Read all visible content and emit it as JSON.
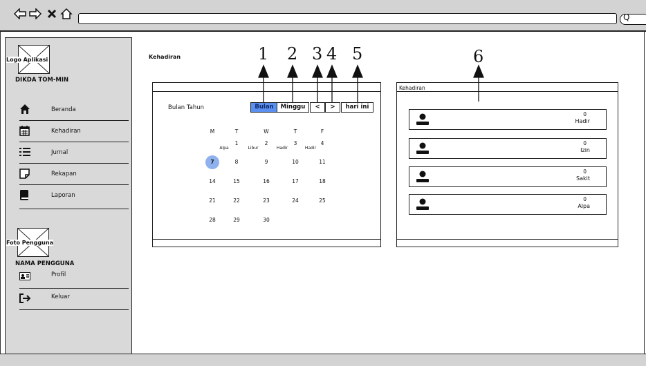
{
  "browser": {
    "back_icon": "back-arrow-icon",
    "forward_icon": "forward-arrow-icon",
    "close_icon": "close-icon",
    "home_icon": "home-icon",
    "search_glyph": "Q"
  },
  "sidebar": {
    "logo_label": "Logo Aplikasi",
    "app_name": "DIKDA TOM-MIN",
    "items": [
      {
        "label": "Beranda",
        "icon": "home-icon"
      },
      {
        "label": "Kehadiran",
        "icon": "calendar-icon"
      },
      {
        "label": "Jurnal",
        "icon": "list-icon"
      },
      {
        "label": "Rekapan",
        "icon": "note-icon"
      },
      {
        "label": "Laporan",
        "icon": "book-icon"
      }
    ],
    "photo_label": "Foto Pengguna",
    "user_name": "NAMA PENGGUNA",
    "user_items": [
      {
        "label": "Profil",
        "icon": "id-card-icon"
      },
      {
        "label": "Keluar",
        "icon": "logout-icon"
      }
    ]
  },
  "page": {
    "title": "Kehadiran"
  },
  "calendar": {
    "month_label": "Bulan Tahun",
    "buttons": {
      "month": "Bulan",
      "week": "Minggu",
      "prev": "<",
      "next": ">",
      "today": "hari ini"
    },
    "active_view": "Bulan",
    "weekdays": [
      "M",
      "T",
      "W",
      "T",
      "F"
    ],
    "rows": [
      [
        "",
        "1",
        "2",
        "3",
        "4"
      ],
      [
        "7",
        "8",
        "9",
        "10",
        "11"
      ],
      [
        "14",
        "15",
        "16",
        "17",
        "18"
      ],
      [
        "21",
        "22",
        "23",
        "24",
        "25"
      ],
      [
        "28",
        "29",
        "30",
        "",
        ""
      ]
    ],
    "notes": [
      "Alpa",
      "Libur",
      "Hadir",
      "Hadir"
    ],
    "today": "7",
    "today_color": "#8fb2ee",
    "active_color": "#5b8ff0"
  },
  "summary": {
    "title": "Kehadiran",
    "cards": [
      {
        "count": "0",
        "label": "Hadir"
      },
      {
        "count": "0",
        "label": "Izin"
      },
      {
        "count": "0",
        "label": "Sakit"
      },
      {
        "count": "0",
        "label": "Alpa"
      }
    ]
  },
  "callouts": [
    "1",
    "2",
    "3",
    "4",
    "5",
    "6"
  ]
}
